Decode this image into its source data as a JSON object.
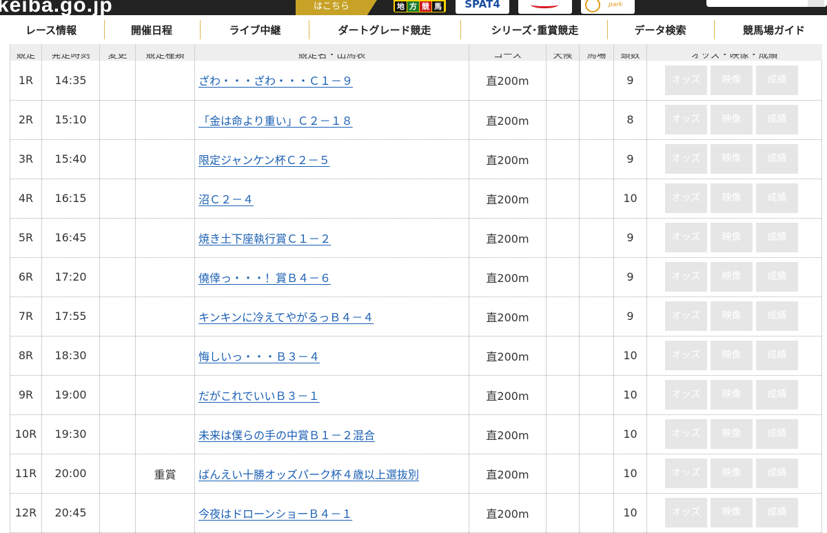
{
  "header": {
    "logo_text": "keiba.go.jp",
    "hakochira": "はこちら",
    "chiho_keiba": [
      "地",
      "方",
      "競",
      "馬"
    ],
    "spat_text": "SPAT4"
  },
  "nav": [
    "レース情報",
    "開催日程",
    "ライブ中継",
    "ダートグレード競走",
    "シリーズ･重賞競走",
    "データ検索",
    "競馬場ガイド"
  ],
  "table": {
    "headers": [
      "競走",
      "発走時刻",
      "変更",
      "競走種類",
      "競走名・出馬表",
      "コース",
      "天候",
      "馬場",
      "頭数",
      "オッズ・映像・成績"
    ],
    "buttons": [
      "オッズ",
      "映像",
      "成績"
    ],
    "rows": [
      {
        "race": "1R",
        "time": "14:35",
        "change": "",
        "type": "",
        "name": "ざわ・・・ざわ・・・Ｃ１－９",
        "course": "直200m",
        "weather": "",
        "track": "",
        "count": "9"
      },
      {
        "race": "2R",
        "time": "15:10",
        "change": "",
        "type": "",
        "name": "「金は命より重い」Ｃ２－１８",
        "course": "直200m",
        "weather": "",
        "track": "",
        "count": "8"
      },
      {
        "race": "3R",
        "time": "15:40",
        "change": "",
        "type": "",
        "name": "限定ジャンケン杯Ｃ２－５",
        "course": "直200m",
        "weather": "",
        "track": "",
        "count": "9"
      },
      {
        "race": "4R",
        "time": "16:15",
        "change": "",
        "type": "",
        "name": "沼Ｃ２－４",
        "course": "直200m",
        "weather": "",
        "track": "",
        "count": "10"
      },
      {
        "race": "5R",
        "time": "16:45",
        "change": "",
        "type": "",
        "name": "焼き土下座執行賞Ｃ１－２",
        "course": "直200m",
        "weather": "",
        "track": "",
        "count": "9"
      },
      {
        "race": "6R",
        "time": "17:20",
        "change": "",
        "type": "",
        "name": "僥倖っ・・・！賞Ｂ４－６",
        "course": "直200m",
        "weather": "",
        "track": "",
        "count": "9"
      },
      {
        "race": "7R",
        "time": "17:55",
        "change": "",
        "type": "",
        "name": "キンキンに冷えてやがるっＢ４－４",
        "course": "直200m",
        "weather": "",
        "track": "",
        "count": "9"
      },
      {
        "race": "8R",
        "time": "18:30",
        "change": "",
        "type": "",
        "name": "悔しいっ・・・Ｂ３－４",
        "course": "直200m",
        "weather": "",
        "track": "",
        "count": "10"
      },
      {
        "race": "9R",
        "time": "19:00",
        "change": "",
        "type": "",
        "name": "だがこれでいいＢ３－１",
        "course": "直200m",
        "weather": "",
        "track": "",
        "count": "10"
      },
      {
        "race": "10R",
        "time": "19:30",
        "change": "",
        "type": "",
        "name": "未来は僕らの手の中賞Ｂ１－２混合",
        "course": "直200m",
        "weather": "",
        "track": "",
        "count": "10"
      },
      {
        "race": "11R",
        "time": "20:00",
        "change": "",
        "type": "重賞",
        "name": "ばんえい十勝オッズパーク杯４歳以上選抜別",
        "course": "直200m",
        "weather": "",
        "track": "",
        "count": "10"
      },
      {
        "race": "12R",
        "time": "20:45",
        "change": "",
        "type": "",
        "name": "今夜はドローンショーＢ４－１",
        "course": "直200m",
        "weather": "",
        "track": "",
        "count": "10"
      }
    ]
  },
  "colors": {
    "link": "#1a5fb4",
    "nav_separator": "#d9b64a",
    "button_disabled": "#e6e6e6",
    "top_bar": "#222222",
    "gold_tab": "#c7a227"
  }
}
